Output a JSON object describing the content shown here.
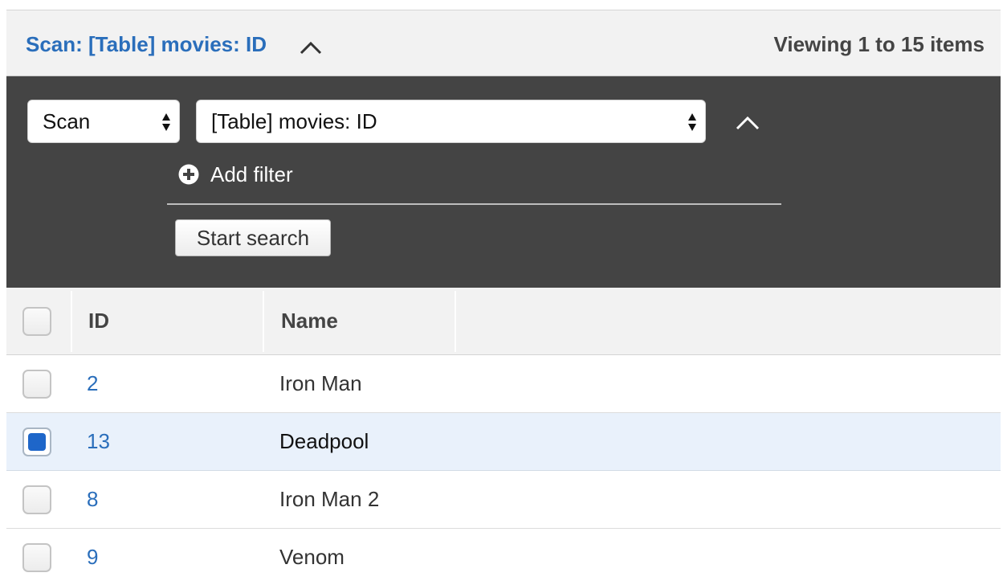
{
  "header": {
    "title": "Scan: [Table] movies: ID",
    "viewing": "Viewing 1 to 15 items"
  },
  "filter": {
    "operation": "Scan",
    "table": "[Table] movies: ID",
    "add_filter": "Add filter",
    "start_search": "Start search"
  },
  "table": {
    "columns": [
      "ID",
      "Name"
    ],
    "rows": [
      {
        "id": "2",
        "name": "Iron Man",
        "checked": false
      },
      {
        "id": "13",
        "name": "Deadpool",
        "checked": true
      },
      {
        "id": "8",
        "name": "Iron Man 2",
        "checked": false
      },
      {
        "id": "9",
        "name": "Venom",
        "checked": false
      }
    ]
  },
  "colors": {
    "link": "#2a6ebb",
    "panel": "#444444",
    "selected_row": "#e9f1fb",
    "checkbox_checked": "#1e66c9"
  }
}
